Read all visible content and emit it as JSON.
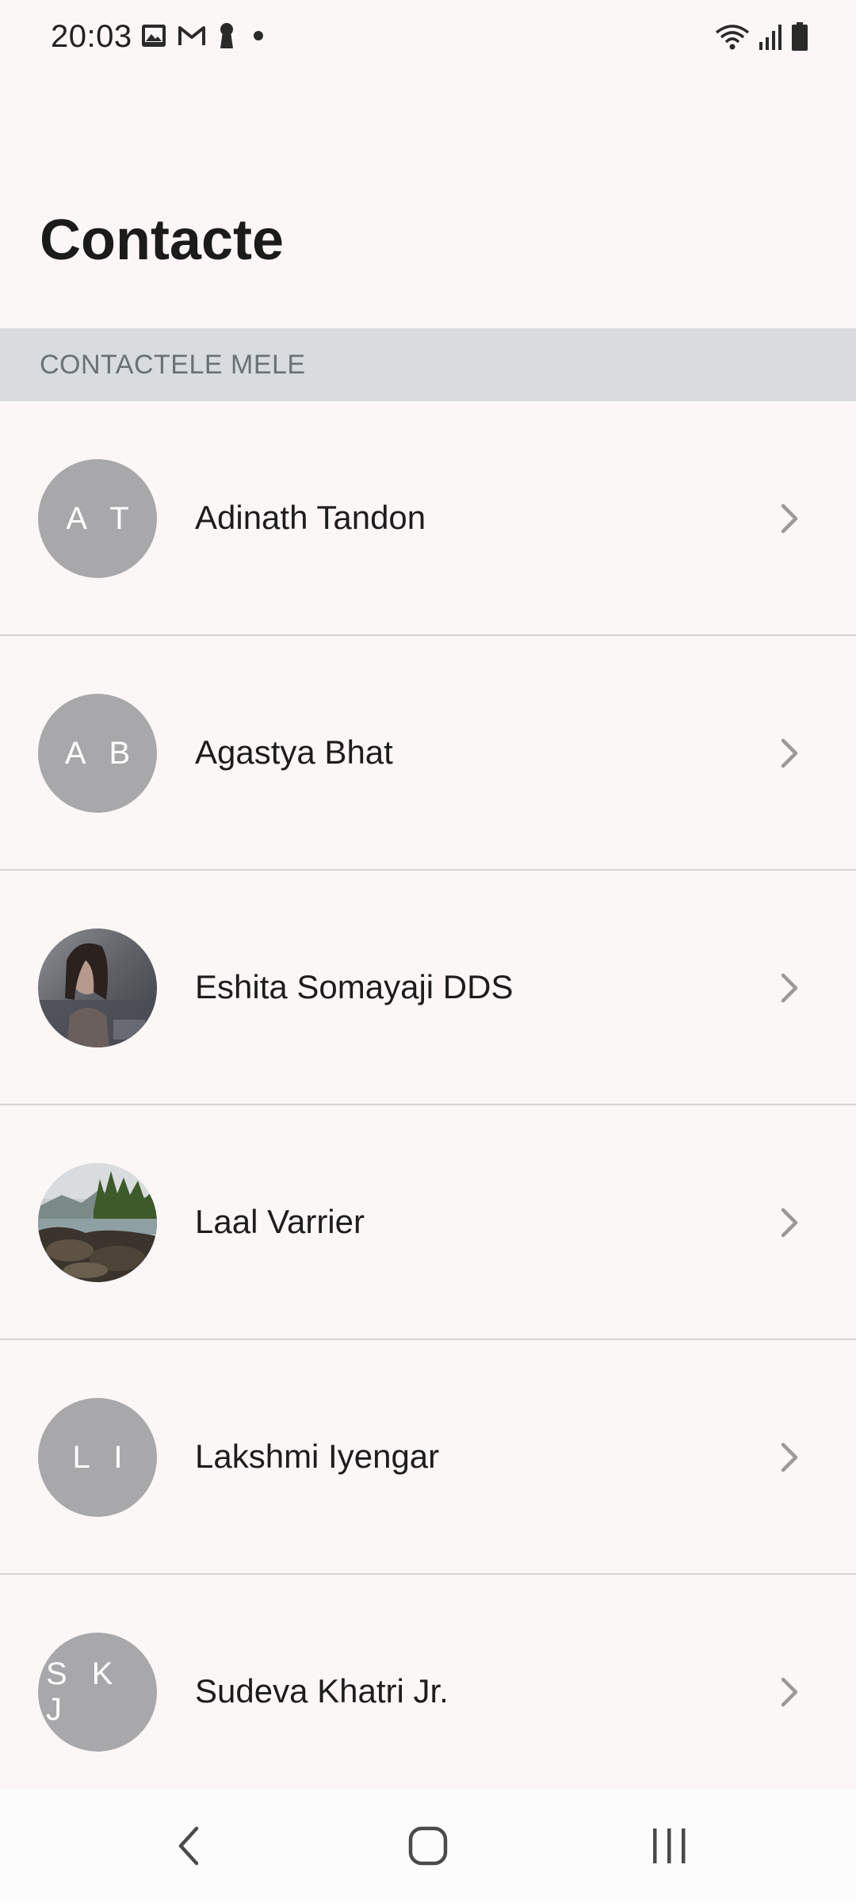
{
  "status_bar": {
    "time": "20:03",
    "left_icons": [
      "image-icon",
      "gmail-icon",
      "keyhole-icon",
      "dot-icon"
    ],
    "right_icons": [
      "wifi-icon",
      "signal-icon",
      "battery-icon"
    ]
  },
  "page": {
    "title": "Contacte"
  },
  "section": {
    "header": "CONTACTELE MELE"
  },
  "contacts": [
    {
      "name": "Adinath Tandon",
      "initials": "A T",
      "avatar_type": "initials"
    },
    {
      "name": "Agastya Bhat",
      "initials": "A B",
      "avatar_type": "initials"
    },
    {
      "name": "Eshita Somayaji DDS",
      "initials": "",
      "avatar_type": "photo-portrait"
    },
    {
      "name": "Laal Varrier",
      "initials": "",
      "avatar_type": "photo-landscape"
    },
    {
      "name": "Lakshmi Iyengar",
      "initials": "L I",
      "avatar_type": "initials"
    },
    {
      "name": "Sudeva Khatri Jr.",
      "initials": "S K J",
      "avatar_type": "initials"
    }
  ],
  "nav_bar": {
    "buttons": [
      "back-icon",
      "home-icon",
      "recents-icon"
    ]
  },
  "colors": {
    "background": "#faf7f6",
    "section_header_bg": "#d8dcdf",
    "avatar_bg": "#a8a8ab",
    "chevron": "#9a9a9a"
  }
}
